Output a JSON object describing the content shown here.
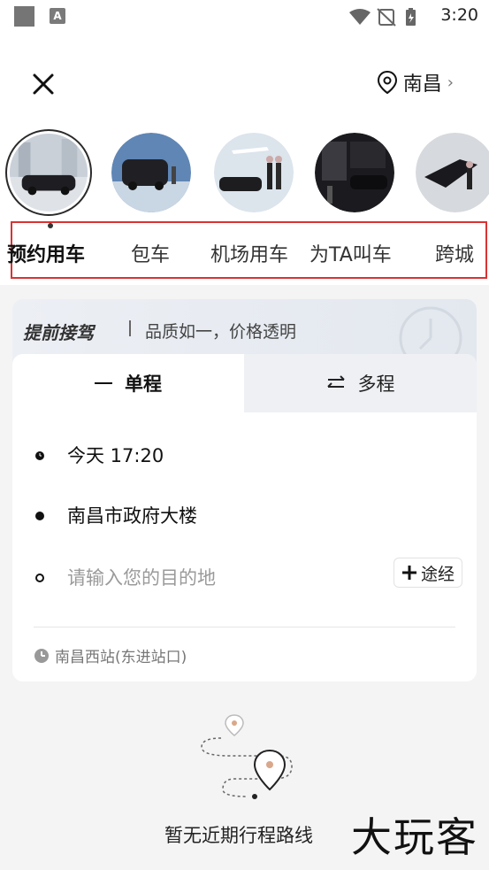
{
  "status_bar": {
    "time": "3:20",
    "icons": [
      "app-square-icon",
      "font-a-icon",
      "wifi-icon",
      "no-sim-icon",
      "battery-icon"
    ]
  },
  "header": {
    "city": "南昌",
    "city_chevron": "›"
  },
  "scenes": {
    "items": [
      {
        "label": "预约用车",
        "active": true
      },
      {
        "label": "包车",
        "active": false
      },
      {
        "label": "机场用车",
        "active": false
      },
      {
        "label": "为TA叫车",
        "active": false
      },
      {
        "label": "跨城",
        "active": false
      }
    ]
  },
  "banner": {
    "title": "提前接驾",
    "subtitle": "品质如一，价格透明"
  },
  "trip_card": {
    "tabs": [
      {
        "label": "单程",
        "active": true
      },
      {
        "label": "多程",
        "active": false
      }
    ],
    "time": "今天 17:20",
    "origin": "南昌市政府大楼",
    "destination_placeholder": "请输入您的目的地",
    "waypoint_label": "途经",
    "suggestion": "南昌西站(东进站口)"
  },
  "empty_state": {
    "text": "暂无近期行程路线"
  },
  "watermark": "大玩客",
  "colors": {
    "accent_highlight": "#d93333",
    "active_text": "#111111",
    "muted": "#9a9a9a"
  }
}
